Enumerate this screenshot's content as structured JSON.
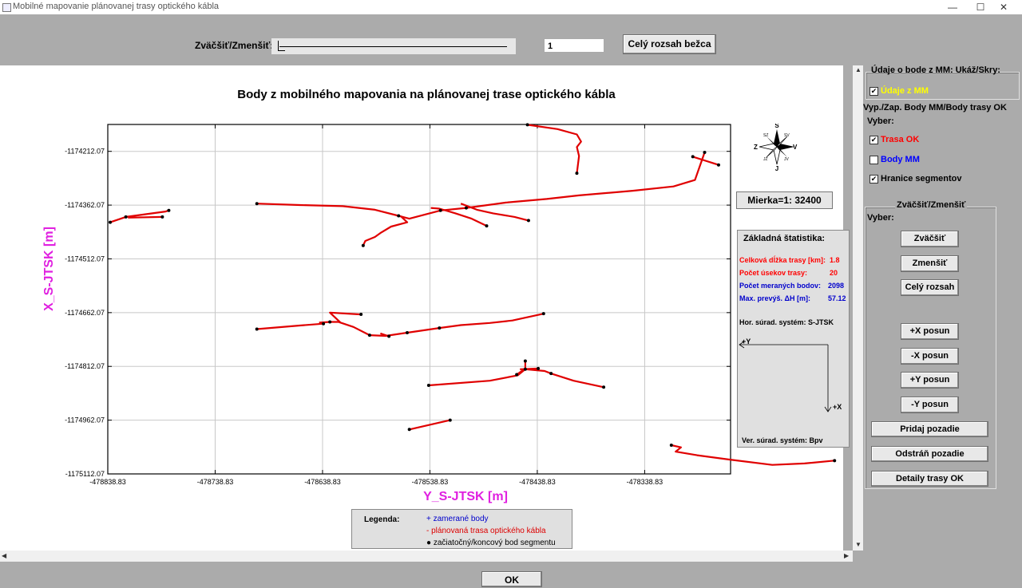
{
  "window": {
    "title": "Mobilné mapovanie plánovanej trasy optického kábla",
    "controls": [
      "—",
      "☐",
      "✕"
    ]
  },
  "toolbar": {
    "zoom_label": "Zväčšiť/Zmenšiť:",
    "zoom_value": "1",
    "full_range_label": "Celý rozsah bežca",
    "zoom_level": 0.03
  },
  "chart_data": {
    "type": "line",
    "title": "Body z mobilného mapovania na plánovanej trase optického kábla",
    "xlabel": "Y_S-JTSK [m]",
    "ylabel": "X_S-JTSK [m]",
    "xlim": [
      -478838.83,
      -478258.83
    ],
    "ylim": [
      -1175112.07,
      -1174137.07
    ],
    "x_ticks": [
      "-478838.83",
      "-478738.83",
      "-478638.83",
      "-478538.83",
      "-478438.83",
      "-478338.83"
    ],
    "y_ticks": [
      "-1174212.07",
      "-1174362.07",
      "-1174512.07",
      "-1174662.07",
      "-1174812.07",
      "-1174962.07",
      "-1175112.07"
    ],
    "grid": true,
    "line_color": "#e00000",
    "series": [
      {
        "points": [
          [
            -478836.6,
            -1174410.0
          ],
          [
            -478822,
            -1174395
          ],
          [
            -478785,
            -1174380
          ],
          [
            -478782,
            -1174377
          ]
        ]
      },
      {
        "points": [
          [
            -478820,
            -1174397
          ],
          [
            -478788,
            -1174395
          ]
        ]
      },
      {
        "points": [
          [
            -478700,
            -1174358
          ],
          [
            -478660,
            -1174362
          ],
          [
            -478620,
            -1174365
          ],
          [
            -478590,
            -1174375
          ],
          [
            -478568,
            -1174392
          ],
          [
            -478558,
            -1174400
          ],
          [
            -478529,
            -1174377
          ],
          [
            -478505,
            -1174370
          ],
          [
            -478468,
            -1174355
          ],
          [
            -478430,
            -1174345
          ],
          [
            -478400,
            -1174335
          ],
          [
            -478350,
            -1174322
          ],
          [
            -478312,
            -1174310
          ],
          [
            -478292,
            -1174292
          ],
          [
            -478283,
            -1174215
          ]
        ]
      },
      {
        "points": [
          [
            -478294,
            -1174227
          ],
          [
            -478270,
            -1174250
          ]
        ]
      },
      {
        "points": [
          [
            -478566,
            -1174393
          ],
          [
            -478560,
            -1174410
          ],
          [
            -478575,
            -1174422
          ],
          [
            -478585,
            -1174440
          ],
          [
            -478590,
            -1174451
          ],
          [
            -478599,
            -1174462
          ],
          [
            -478601,
            -1174475
          ]
        ]
      },
      {
        "points": [
          [
            -478538,
            -1174370
          ],
          [
            -478530,
            -1174372
          ],
          [
            -478515,
            -1174385
          ],
          [
            -478500,
            -1174400
          ],
          [
            -478486,
            -1174420
          ]
        ]
      },
      {
        "points": [
          [
            -478510,
            -1174358
          ],
          [
            -478495,
            -1174375
          ],
          [
            -478480,
            -1174385
          ],
          [
            -478460,
            -1174395
          ],
          [
            -478447,
            -1174405
          ]
        ]
      },
      {
        "points": [
          [
            -478448,
            -1174138
          ],
          [
            -478420,
            -1174150
          ],
          [
            -478402,
            -1174165
          ],
          [
            -478398,
            -1174185
          ],
          [
            -478402,
            -1174200
          ],
          [
            -478400,
            -1174225
          ],
          [
            -478402,
            -1174273
          ]
        ]
      },
      {
        "points": [
          [
            -478700,
            -1174708
          ],
          [
            -478660,
            -1174698
          ],
          [
            -478638,
            -1174693
          ]
        ]
      },
      {
        "points": [
          [
            -478642,
            -1174690
          ],
          [
            -478632,
            -1174688
          ],
          [
            -478624,
            -1174688
          ],
          [
            -478622,
            -1174690
          ],
          [
            -478620,
            -1174692
          ],
          [
            -478610,
            -1174702
          ],
          [
            -478595,
            -1174725
          ],
          [
            -478580,
            -1174727
          ],
          [
            -478560,
            -1174718
          ],
          [
            -478530,
            -1174705
          ],
          [
            -478510,
            -1174697
          ],
          [
            -478483,
            -1174691
          ],
          [
            -478462,
            -1174684
          ],
          [
            -478433,
            -1174665
          ]
        ]
      },
      {
        "points": [
          [
            -478622,
            -1174690
          ],
          [
            -478632,
            -1174662
          ],
          [
            -478603,
            -1174667
          ]
        ]
      },
      {
        "points": [
          [
            -478577,
            -1174728
          ],
          [
            -478585,
            -1174720
          ]
        ]
      },
      {
        "points": [
          [
            -478540,
            -1174865
          ],
          [
            -478483,
            -1174852
          ],
          [
            -478457,
            -1174837
          ],
          [
            -478450,
            -1174820
          ],
          [
            -478432,
            -1174825
          ],
          [
            -478426,
            -1174832
          ],
          [
            -478405,
            -1174852
          ],
          [
            -478377,
            -1174870
          ]
        ]
      },
      {
        "points": [
          [
            -478458,
            -1174835
          ],
          [
            -478450,
            -1174818
          ],
          [
            -478450,
            -1174797
          ]
        ]
      },
      {
        "points": [
          [
            -478438,
            -1174818
          ],
          [
            -478455,
            -1174820
          ]
        ]
      },
      {
        "points": [
          [
            -478558,
            -1174988
          ],
          [
            -478520,
            -1174962
          ]
        ]
      },
      {
        "points": [
          [
            -478314,
            -1175032
          ],
          [
            -478305,
            -1175038
          ],
          [
            -478310,
            -1175050
          ],
          [
            -478290,
            -1175060
          ],
          [
            -478260,
            -1175072
          ],
          [
            -478220,
            -1175087
          ],
          [
            -478190,
            -1175083
          ],
          [
            -478162,
            -1175075
          ]
        ]
      }
    ],
    "nodes": [
      [
        -478836.6,
        -1174410.0
      ],
      [
        -478822,
        -1174395
      ],
      [
        -478788,
        -1174395
      ],
      [
        -478782,
        -1174377
      ],
      [
        -478700,
        -1174358
      ],
      [
        -478568,
        -1174392
      ],
      [
        -478529,
        -1174377
      ],
      [
        -478505,
        -1174370
      ],
      [
        -478294,
        -1174227
      ],
      [
        -478283,
        -1174215
      ],
      [
        -478270,
        -1174250
      ],
      [
        -478601,
        -1174475
      ],
      [
        -478486,
        -1174420
      ],
      [
        -478447,
        -1174405
      ],
      [
        -478448,
        -1174138
      ],
      [
        -478402,
        -1174273
      ],
      [
        -478700,
        -1174708
      ],
      [
        -478638,
        -1174693
      ],
      [
        -478632,
        -1174688
      ],
      [
        -478603,
        -1174667
      ],
      [
        -478595,
        -1174725
      ],
      [
        -478577,
        -1174728
      ],
      [
        -478560,
        -1174718
      ],
      [
        -478530,
        -1174705
      ],
      [
        -478433,
        -1174665
      ],
      [
        -478540,
        -1174865
      ],
      [
        -478458,
        -1174835
      ],
      [
        -478450,
        -1174797
      ],
      [
        -478450,
        -1174820
      ],
      [
        -478438,
        -1174818
      ],
      [
        -478426,
        -1174832
      ],
      [
        -478377,
        -1174870
      ],
      [
        -478558,
        -1174988
      ],
      [
        -478520,
        -1174962
      ],
      [
        -478314,
        -1175032
      ],
      [
        -478162,
        -1175075
      ]
    ]
  },
  "compass": {
    "north": "S",
    "south": "J",
    "west": "Z",
    "east": "V",
    "ne": "SV",
    "nw": "SZ",
    "se": "JV",
    "sw": "JZ"
  },
  "scale": {
    "label": "Mierka=1: 32400"
  },
  "stats": {
    "title": "Základná štatistika:",
    "length_label": "Celková dĺžka trasy [km]:",
    "length_value": "1.8",
    "segments_label": "Počet úsekov trasy:",
    "segments_value": "20",
    "points_label": "Počet meraných bodov:",
    "points_value": "2098",
    "dh_label": "Max. prevýš. ΔH [m]:",
    "dh_value": "57.12",
    "hor_system": "Hor. súrad. systém: S-JTSK",
    "axis_y": "+Y",
    "axis_x": "+X",
    "ver_system": "Ver. súrad. systém: Bpv"
  },
  "legend": {
    "title": "Legenda:",
    "item1": "+ zamerané body",
    "item2": "- plánovaná trasa optického kábla",
    "item3": "● začiatočný/koncový bod segmentu"
  },
  "panel": {
    "mm_header": "Údaje o bode z MM: Ukáž/Skry:",
    "mm_checkbox": "Údaje z MM",
    "vyp_header": "Vyp./Zap. Body MM/Body trasy OK",
    "vyber1": "Vyber:",
    "trasa_ok": "Trasa OK",
    "body_mm": "Body MM",
    "hranice": "Hranice segmentov",
    "zoom_group": "Zväčšiť/Zmenšiť",
    "vyber2": "Vyber:",
    "zoom_in": "Zväčšiť",
    "zoom_out": "Zmenšiť",
    "full_range": "Celý rozsah",
    "plus_x": "+X posun",
    "minus_x": "-X posun",
    "plus_y": "+Y posun",
    "minus_y": "-Y posun",
    "add_bg": "Pridaj pozadie",
    "remove_bg": "Odstráň pozadie",
    "route_details": "Detaily trasy OK"
  },
  "colors": {
    "magenta_axis": "#e020e0",
    "route_red": "#e00000",
    "mm_yellow": "#ffff00",
    "body_blue": "#0000ff"
  },
  "footer": {
    "ok": "OK"
  }
}
